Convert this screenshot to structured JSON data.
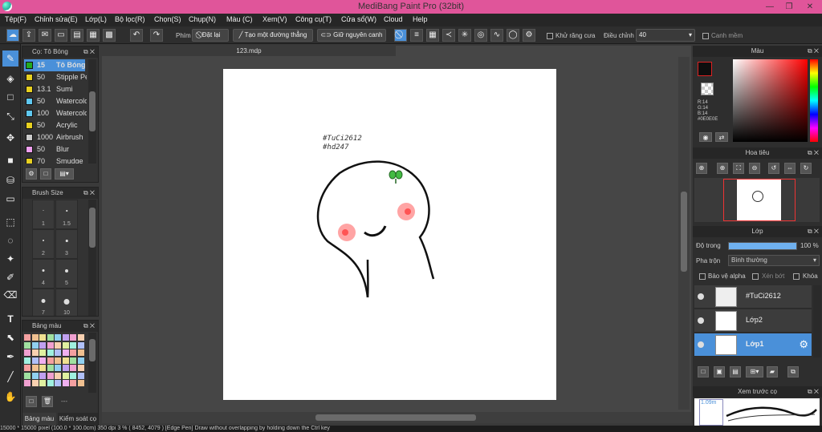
{
  "window": {
    "title": "MediBang Paint Pro (32bit)"
  },
  "menu": [
    "Tệp(F)",
    "Chỉnh sửa(E)",
    "Lớp(L)",
    "Bộ lọc(R)",
    "Chọn(S)",
    "Chụp(N)",
    "Màu (C)",
    "Xem(V)",
    "Công cụ(T)",
    "Cửa sổ(W)",
    "Cloud",
    "Help"
  ],
  "toolbar": {
    "pen_label": "Phím",
    "reset_label": "Đặt lại",
    "line_label": "Tạo một đường thẳng",
    "keep_edge_label": "Giữ nguyên canh",
    "antialias_label": "Khử răng cưa",
    "adjust_label": "Điều chỉnh",
    "adjust_value": "40",
    "smooth_label": "Canh mềm"
  },
  "brush_panel": {
    "title": "Cọ: Tô Bóng",
    "items": [
      {
        "size": "15",
        "name": "Tô Bóng",
        "color": "#22aa22",
        "selected": true
      },
      {
        "size": "50",
        "name": "Stipple Pe",
        "color": "#e8d020"
      },
      {
        "size": "13.1",
        "name": "Sumi",
        "color": "#e8d020"
      },
      {
        "size": "50",
        "name": "Watercolo",
        "color": "#5fc8f0"
      },
      {
        "size": "100",
        "name": "Watercolo",
        "color": "#5fc8f0"
      },
      {
        "size": "50",
        "name": "Acrylic",
        "color": "#e8d020"
      },
      {
        "size": "1000",
        "name": "Airbrush",
        "color": "#cccccc"
      },
      {
        "size": "50",
        "name": "Blur",
        "color": "#f0a0f0"
      },
      {
        "size": "70",
        "name": "Smudge",
        "color": "#e8d020"
      }
    ]
  },
  "brush_size_panel": {
    "title": "Brush Size",
    "cells": [
      "1",
      "1.5",
      "2",
      "3",
      "4",
      "5",
      "7",
      "10"
    ]
  },
  "palette_panel": {
    "title": "Bảng màu",
    "tabs": [
      "Bảng màu",
      "Kiểm soát cọ"
    ],
    "footer_text": "---"
  },
  "document": {
    "tab": "123.mdp",
    "text_line1": "#TuCi2612",
    "text_line2": "#hd247"
  },
  "color_panel": {
    "title": "Màu",
    "r": "R:14",
    "g": "G:14",
    "b": "B:14",
    "hex": "#0E0E0E"
  },
  "navigator_panel": {
    "title": "Hoa tiêu"
  },
  "layer_panel": {
    "title": "Lớp",
    "opacity_label": "Độ trong",
    "opacity_value": "100 %",
    "opacity_fraction": 1.0,
    "blend_label": "Pha trộn",
    "blend_value": "Bình thường",
    "protect_alpha": "Bảo vệ alpha",
    "clip": "Xén bớt",
    "lock": "Khóa",
    "layers": [
      {
        "name": "#TuCi2612",
        "selected": false
      },
      {
        "name": "Lớp2",
        "selected": false
      },
      {
        "name": "Lớp1",
        "selected": true
      }
    ]
  },
  "preview_panel": {
    "title": "Xem trước cọ",
    "size": "1.09m"
  },
  "status": {
    "text": "15000 * 15000 pixel   (100.0 * 100.0cm)   350 dpi   3 %   ( 8452, 4079 )   [Edge Pen] Draw without overlapping by holding down the Ctrl key"
  },
  "colors": {
    "accent": "#4a90d9",
    "titlebar": "#e0559a"
  }
}
